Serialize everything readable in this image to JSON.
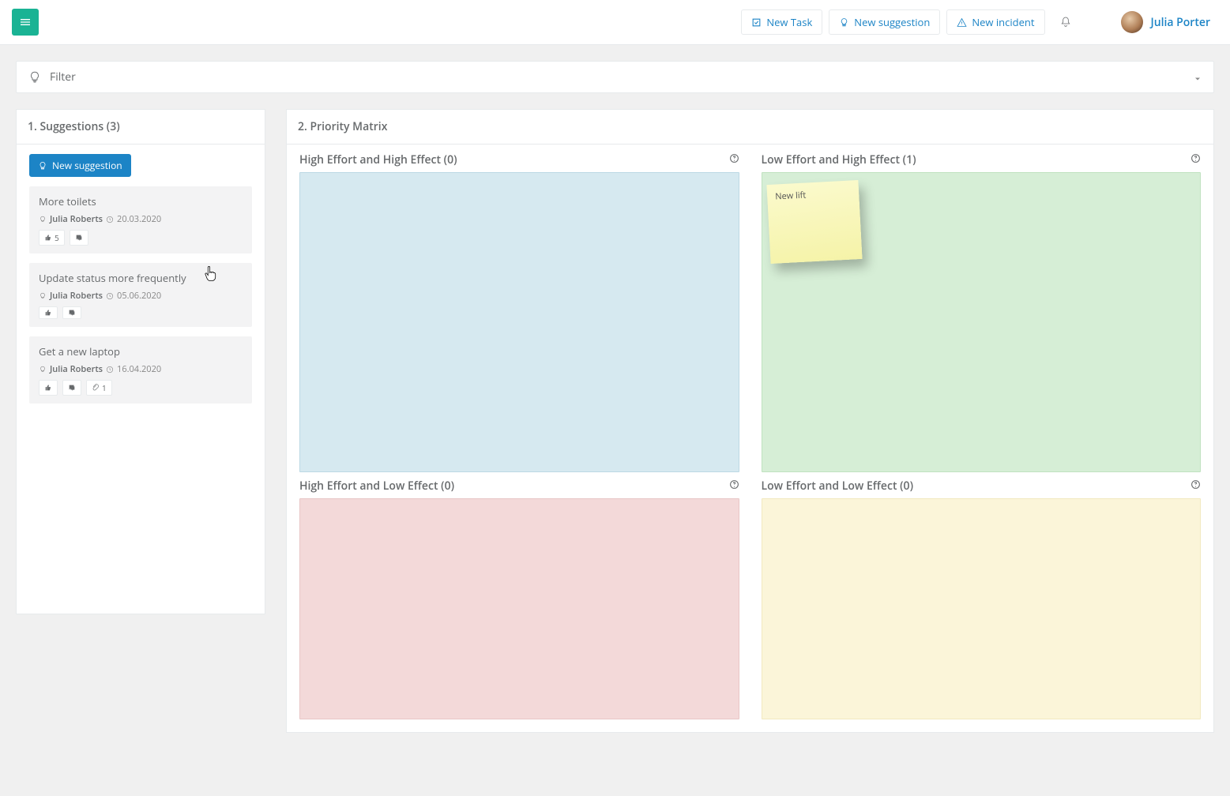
{
  "header": {
    "new_task_label": "New Task",
    "new_suggestion_label": "New suggestion",
    "new_incident_label": "New incident",
    "user_name": "Julia Porter"
  },
  "filter": {
    "label": "Filter"
  },
  "suggestions_panel": {
    "title": "1. Suggestions (3)",
    "new_suggestion_button": "New suggestion",
    "items": [
      {
        "title": "More toilets",
        "author": "Julia Roberts",
        "date": "20.03.2020",
        "likes": "5",
        "comments": "",
        "attachments": ""
      },
      {
        "title": "Update status more frequently",
        "author": "Julia Roberts",
        "date": "05.06.2020",
        "likes": "",
        "comments": "",
        "attachments": ""
      },
      {
        "title": "Get a new laptop",
        "author": "Julia Roberts",
        "date": "16.04.2020",
        "likes": "",
        "comments": "",
        "attachments": "1"
      }
    ]
  },
  "matrix_panel": {
    "title": "2. Priority Matrix",
    "quadrants": [
      {
        "label": "High Effort and High Effect (0)",
        "color": "blue",
        "notes": []
      },
      {
        "label": "Low Effort and High Effect (1)",
        "color": "green",
        "notes": [
          {
            "text": "New lift"
          }
        ]
      },
      {
        "label": "High Effort and Low Effect (0)",
        "color": "red",
        "notes": []
      },
      {
        "label": "Low Effort and Low Effect (0)",
        "color": "yellow",
        "notes": []
      }
    ]
  },
  "colors": {
    "primary": "#1c84c6",
    "accent": "#1ab394"
  }
}
